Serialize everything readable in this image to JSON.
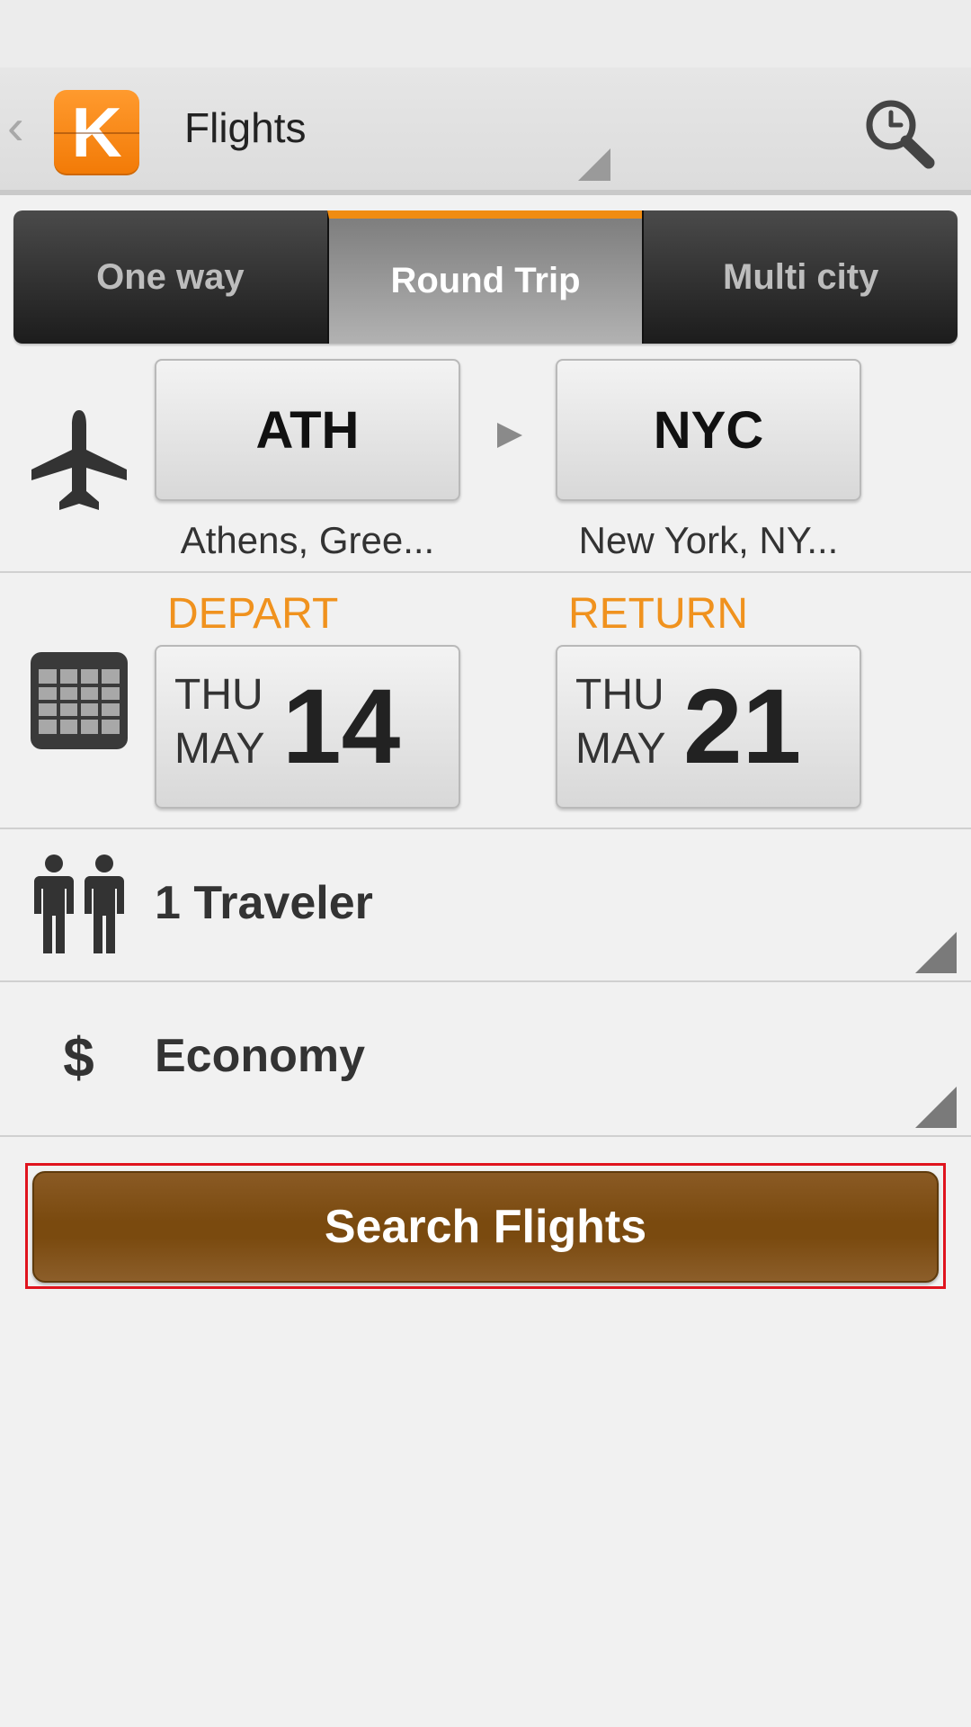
{
  "header": {
    "title": "Flights",
    "back_icon": "chevron-left-icon",
    "logo_letter": "K",
    "history_icon": "clock-search-icon"
  },
  "trip_tabs": [
    {
      "label": "One way",
      "active": false
    },
    {
      "label": "Round Trip",
      "active": true
    },
    {
      "label": "Multi city",
      "active": false
    }
  ],
  "route": {
    "icon": "airplane-icon",
    "origin": {
      "code": "ATH",
      "city": "Athens, Gree..."
    },
    "destination": {
      "code": "NYC",
      "city": "New York, NY..."
    }
  },
  "dates": {
    "icon": "calendar-icon",
    "depart": {
      "label": "DEPART",
      "dow": "THU",
      "month": "MAY",
      "day": "14"
    },
    "return": {
      "label": "RETURN",
      "dow": "THU",
      "month": "MAY",
      "day": "21"
    }
  },
  "travelers": {
    "icon": "people-icon",
    "value": "1 Traveler"
  },
  "cabin": {
    "icon": "dollar-icon",
    "value": "Economy"
  },
  "search_button": {
    "label": "Search Flights"
  },
  "colors": {
    "accent": "#f0921e",
    "search_button": "#7a4a0f",
    "highlight": "#e0141e"
  }
}
